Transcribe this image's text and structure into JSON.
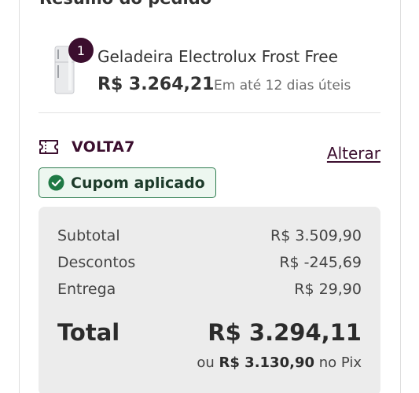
{
  "summary_title": "Resumo do pedido",
  "product": {
    "quantity": "1",
    "name": "Geladeira Electrolux Frost Free",
    "price": "R$ 3.264,21",
    "delivery": "Em até 12 dias úteis"
  },
  "coupon": {
    "code": "VOLTA7",
    "change_label": "Alterar",
    "status": "Cupom aplicado"
  },
  "totals": {
    "subtotal_label": "Subtotal",
    "subtotal_value": "R$ 3.509,90",
    "discounts_label": "Descontos",
    "discounts_value": "R$ -245,69",
    "shipping_label": "Entrega",
    "shipping_value": "R$ 29,90",
    "total_label": "Total",
    "total_value": "R$ 3.294,11",
    "pix_prefix": "ou",
    "pix_value": "R$ 3.130,90",
    "pix_suffix": "no Pix"
  },
  "colors": {
    "brand": "#3b0e2e",
    "success": "#2e7d4f",
    "summary_bg": "#ececec"
  },
  "icons": {
    "coupon": "ticket-icon",
    "applied": "check-circle-icon"
  }
}
